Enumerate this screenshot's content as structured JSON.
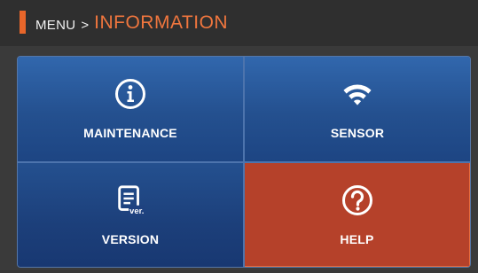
{
  "header": {
    "menu_label": "MENU",
    "separator": ">",
    "current_label": "INFORMATION",
    "accent_color": "#e8662a"
  },
  "tiles": [
    {
      "label": "MAINTENANCE",
      "icon": "info-icon"
    },
    {
      "label": "SENSOR",
      "icon": "wifi-icon"
    },
    {
      "label": "VERSION",
      "icon": "version-icon",
      "icon_text": "ver."
    },
    {
      "label": "HELP",
      "icon": "help-icon",
      "selected": true
    }
  ],
  "colors": {
    "tile_blue": "#2a5a9d",
    "tile_selected": "#b5412a",
    "background": "#3a3a3a"
  }
}
